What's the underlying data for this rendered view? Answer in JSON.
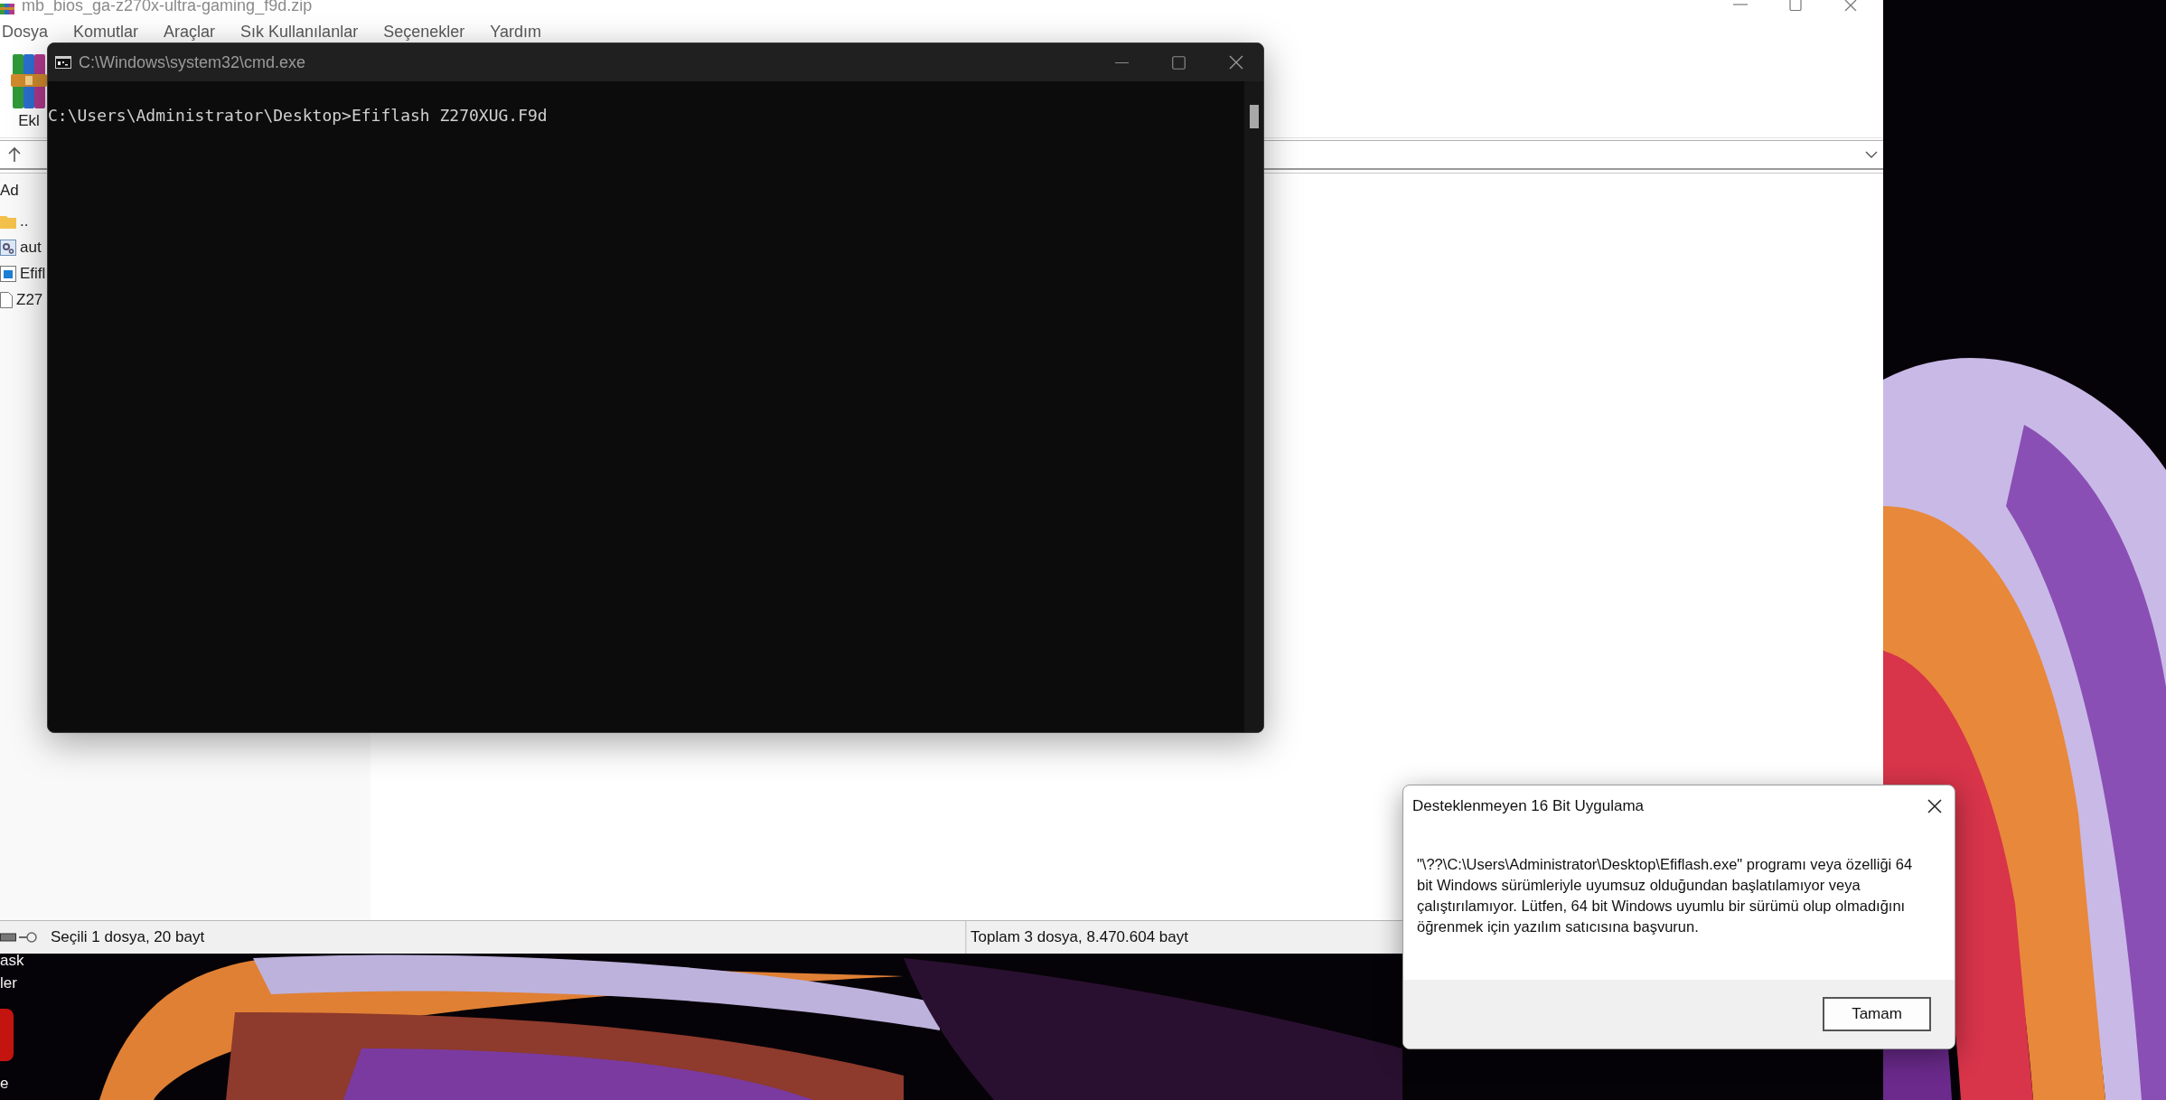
{
  "archive_window": {
    "title": "mb_bios_ga-z270x-ultra-gaming_f9d.zip",
    "menu": [
      {
        "label": "Dosya"
      },
      {
        "label": "Komutlar"
      },
      {
        "label": "Araçlar"
      },
      {
        "label": "Sık Kullanılanlar"
      },
      {
        "label": "Seçenekler"
      },
      {
        "label": "Yardım"
      }
    ],
    "toolbar": [
      {
        "label": "Ekl"
      }
    ],
    "file_list": {
      "columns": [
        "Ad"
      ],
      "rows": [
        {
          "name": "..",
          "kind": "folder"
        },
        {
          "name": "aut",
          "kind": "script"
        },
        {
          "name": "Efifl",
          "kind": "program"
        },
        {
          "name": "Z27",
          "kind": "file"
        }
      ]
    },
    "status_bar": {
      "selection": "Seçili 1 dosya, 20 bayt",
      "total": "Toplam 3 dosya, 8.470.604 bayt"
    }
  },
  "console": {
    "title": "C:\\Windows\\system32\\cmd.exe",
    "lines": [
      "C:\\Users\\Administrator\\Desktop>Efiflash Z270XUG.F9d"
    ]
  },
  "dialog": {
    "title": "Desteklenmeyen 16 Bit Uygulama",
    "message": "\"\\??\\C:\\Users\\Administrator\\Desktop\\Efiflash.exe\" programı veya özelliği 64 bit Windows sürümleriyle uyumsuz olduğundan başlatılamıyor veya çalıştırılamıyor. Lütfen, 64 bit Windows uyumlu bir sürümü olup olmadığını öğrenmek için yazılım satıcısına başvurun.",
    "buttons": [
      "Tamam"
    ]
  },
  "desktop": {
    "icon_labels": [
      "ask",
      "ler",
      "e"
    ]
  }
}
